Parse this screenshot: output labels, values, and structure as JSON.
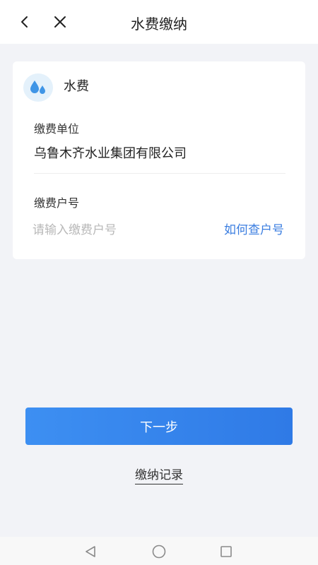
{
  "header": {
    "title": "水费缴纳",
    "back_icon": "chevron-left-icon",
    "close_icon": "close-icon"
  },
  "service": {
    "icon": "water-drops-icon",
    "name": "水费"
  },
  "form": {
    "unit_label": "缴费单位",
    "unit_value": "乌鲁木齐水业集团有限公司",
    "account_label": "缴费户号",
    "account_placeholder": "请输入缴费户号",
    "account_value": "",
    "how_to_find_label": "如何查户号"
  },
  "actions": {
    "next_label": "下一步",
    "records_label": "缴纳记录"
  },
  "navbar": {
    "back_icon": "triangle-back-icon",
    "home_icon": "circle-home-icon",
    "recents_icon": "square-recents-icon"
  },
  "colors": {
    "accent": "#3a7de0",
    "button": "#3d8ff2",
    "icon_bg": "#e4f1fb",
    "icon_drop": "#3f95e6"
  }
}
